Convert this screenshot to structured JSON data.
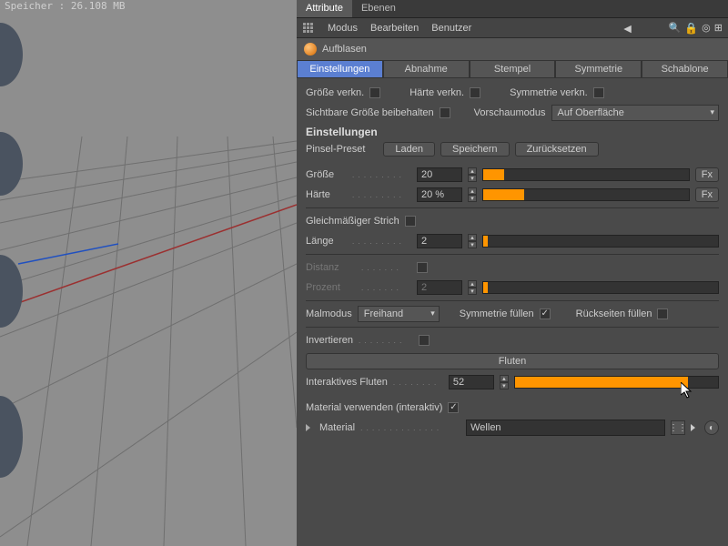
{
  "viewport": {
    "info_line1": "Speicher     : 26.108 MB"
  },
  "tabs": {
    "attribute": "Attribute",
    "ebenen": "Ebenen"
  },
  "menu": {
    "modus": "Modus",
    "bearbeiten": "Bearbeiten",
    "benutzer": "Benutzer"
  },
  "tool": {
    "name": "Aufblasen"
  },
  "sub_tabs": {
    "einstellungen": "Einstellungen",
    "abnahme": "Abnahme",
    "stempel": "Stempel",
    "symmetrie": "Symmetrie",
    "schablone": "Schablone"
  },
  "labels": {
    "groesse_verkn": "Größe verkn.",
    "haerte_verkn": "Härte verkn.",
    "symmetrie_verkn": "Symmetrie verkn.",
    "sichtbare_groesse": "Sichtbare Größe beibehalten",
    "vorschaumodus": "Vorschaumodus",
    "auf_oberflaeche": "Auf Oberfläche",
    "einstellungen": "Einstellungen",
    "pinsel_preset": "Pinsel-Preset",
    "laden": "Laden",
    "speichern": "Speichern",
    "zuruecksetzen": "Zurücksetzen",
    "groesse": "Größe",
    "haerte": "Härte",
    "fx": "Fx",
    "gleichmaessiger": "Gleichmäßiger Strich",
    "laenge": "Länge",
    "distanz": "Distanz",
    "prozent": "Prozent",
    "malmodus": "Malmodus",
    "freihand": "Freihand",
    "symmetrie_fuellen": "Symmetrie füllen",
    "rueckseiten": "Rückseiten füllen",
    "invertieren": "Invertieren",
    "fluten": "Fluten",
    "interaktives_fluten": "Interaktives Fluten",
    "material_verwenden": "Material verwenden (interaktiv)",
    "material": "Material",
    "wellen": "Wellen"
  },
  "values": {
    "groesse": "20",
    "haerte": "20 %",
    "laenge": "2",
    "prozent": "2",
    "interaktives_fluten": "52"
  },
  "sliders": {
    "groesse_pct": 10,
    "haerte_pct": 20,
    "laenge_pct": 2,
    "prozent_pct": 2,
    "fluten_pct": 85
  }
}
